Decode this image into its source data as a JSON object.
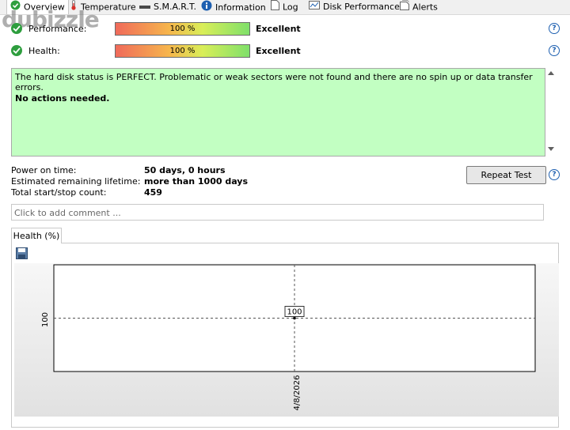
{
  "tabs": [
    {
      "label": "Overview",
      "icon": "green-check-icon"
    },
    {
      "label": "Temperature",
      "icon": "thermometer-icon"
    },
    {
      "label": "S.M.A.R.T.",
      "icon": "drive-icon"
    },
    {
      "label": "Information",
      "icon": "info-icon"
    },
    {
      "label": "Log",
      "icon": "document-icon"
    },
    {
      "label": "Disk Performance",
      "icon": "performance-chart-icon"
    },
    {
      "label": "Alerts",
      "icon": "alerts-icon"
    }
  ],
  "watermark": "dubizzle",
  "status": {
    "performance": {
      "label": "Performance:",
      "value_text": "100 %",
      "value": 100,
      "result": "Excellent"
    },
    "health": {
      "label": "Health:",
      "value_text": "100 %",
      "value": 100,
      "result": "Excellent"
    },
    "help_glyph": "?"
  },
  "message": {
    "line1": "The hard disk status is PERFECT. Problematic or weak sectors were not found and there are no spin up or data transfer errors.",
    "line2": "No actions needed."
  },
  "info": [
    {
      "label": "Power on time:",
      "value": "50 days, 0 hours"
    },
    {
      "label": "Estimated remaining lifetime:",
      "value": "more than 1000 days"
    },
    {
      "label": "Total start/stop count:",
      "value": "459"
    }
  ],
  "repeat_button": "Repeat Test",
  "comment": {
    "placeholder": "Click to add comment ..."
  },
  "health_tab": "Health (%)",
  "colors": {
    "status_bg": "#c2ffc2",
    "check": "#2e9e3e",
    "help": "#1d5fb0"
  },
  "chart_data": {
    "type": "line",
    "title": "",
    "xlabel": "",
    "ylabel": "",
    "x": [
      "4/8/2026"
    ],
    "series": [
      {
        "values": [
          100
        ]
      }
    ],
    "ytick": "100",
    "xtick": "4/8/2026",
    "data_label": "100",
    "grid": true
  }
}
